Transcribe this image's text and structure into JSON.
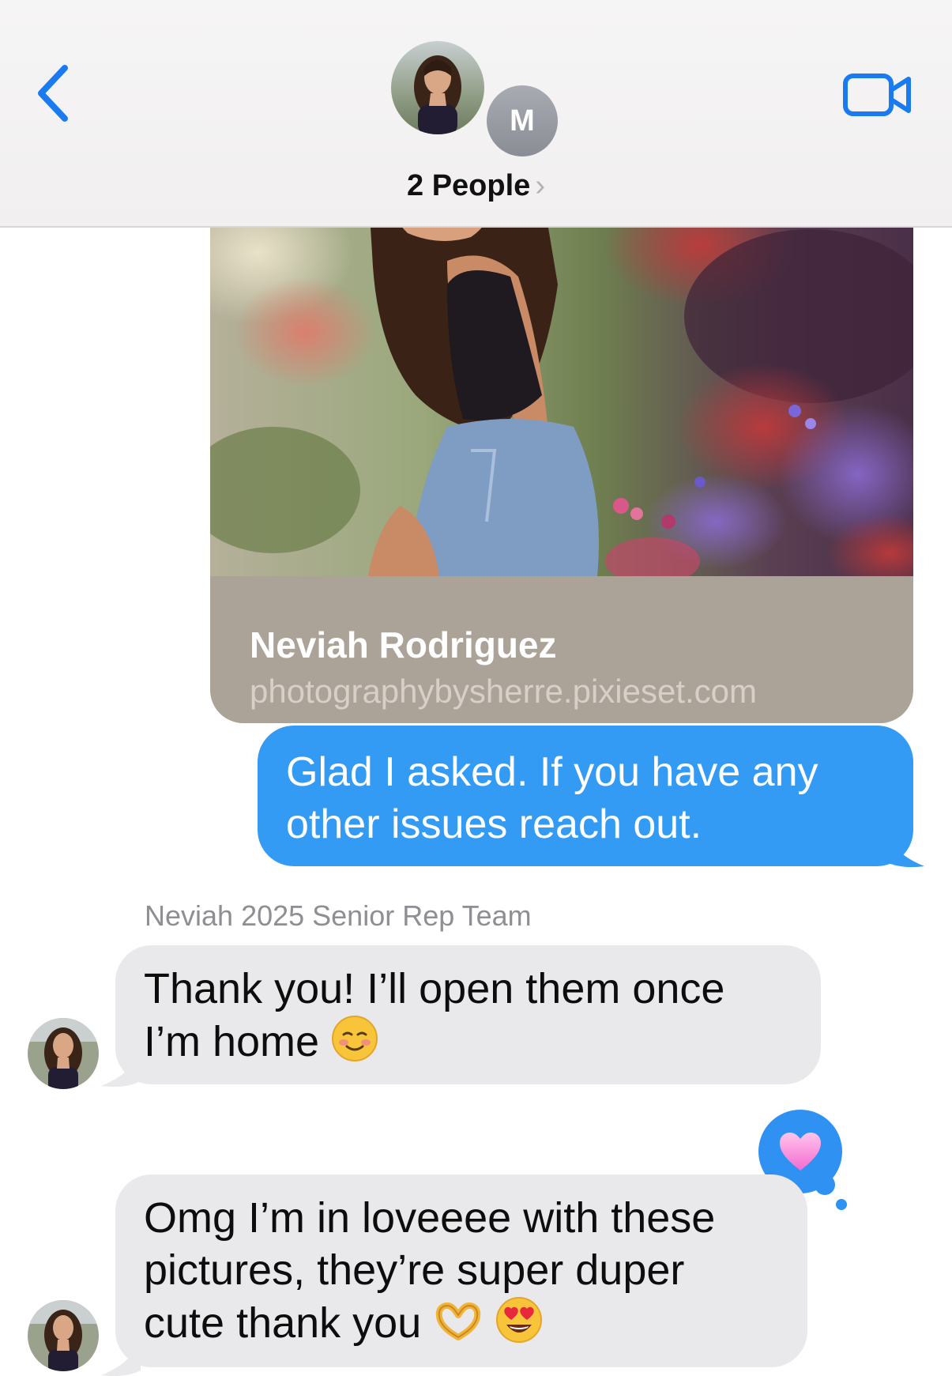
{
  "header": {
    "group_title": "2 People",
    "chevron": "›",
    "second_member_initial": "M",
    "icons": {
      "back": "chevron-left-icon",
      "video": "video-camera-icon",
      "title_chevron": "chevron-right-icon"
    }
  },
  "link_preview": {
    "title": "Neviah Rodriguez",
    "url": "photographybysherre.pixieset.com"
  },
  "messages": {
    "outgoing_1": {
      "line1": "Glad I asked. If you have any",
      "line2": "other issues reach out."
    },
    "sender_name": "Neviah 2025 Senior Rep Team",
    "incoming_1": {
      "line1": "Thank you! I’ll open them once",
      "line2": "I’m home"
    },
    "incoming_2": {
      "line1": "Omg I’m in loveeee with these",
      "line2": "pictures, they’re super duper",
      "line3": "cute thank you"
    }
  },
  "tapback": {
    "reaction": "heart"
  },
  "colors": {
    "ios_blue": "#349bf4",
    "incoming_bubble": "#e9e9eb",
    "link_meta_bg": "#aca398",
    "header_bg": "#f4f2f2"
  }
}
